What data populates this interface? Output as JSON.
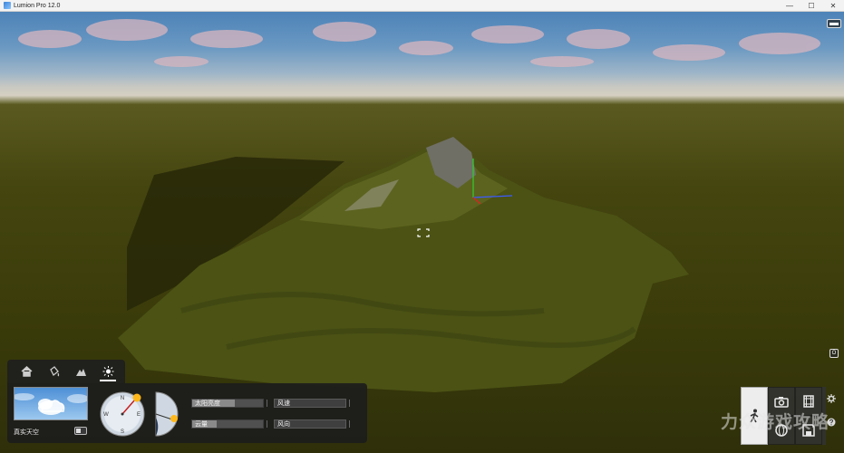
{
  "window": {
    "title": "Lumion Pro 12.0",
    "controls": {
      "minimize": "—",
      "maximize": "☐",
      "close": "✕"
    }
  },
  "viewport": {
    "side_button_label": "O"
  },
  "weather_panel": {
    "tabs": [
      {
        "icon": "home-icon"
      },
      {
        "icon": "paint-bucket-icon"
      },
      {
        "icon": "mountain-icon"
      },
      {
        "icon": "sun-icon",
        "active": true
      }
    ],
    "sky_label": "真实天空",
    "sliders": {
      "sun_brightness": {
        "label": "太阳亮度",
        "level": 0.6
      },
      "cloud_amount": {
        "label": "云量",
        "level": 0.35
      },
      "wind_speed": {
        "label": "风速",
        "level": 0
      },
      "wind_direction": {
        "label": "风向",
        "level": 0
      }
    },
    "compass_labels": {
      "n": "N",
      "e": "E",
      "s": "S",
      "w": "W"
    }
  },
  "modes": {
    "items": [
      {
        "name": "walk-mode",
        "icon": "walker-icon",
        "active": true
      },
      {
        "name": "photo-mode",
        "icon": "camera-icon"
      },
      {
        "name": "movie-mode",
        "icon": "film-icon"
      },
      {
        "name": "360-mode",
        "icon": "globe-icon"
      },
      {
        "name": "save",
        "icon": "save-icon"
      }
    ],
    "side": [
      "gear-icon",
      "help-icon"
    ]
  },
  "watermark": "力众游戏攻略"
}
